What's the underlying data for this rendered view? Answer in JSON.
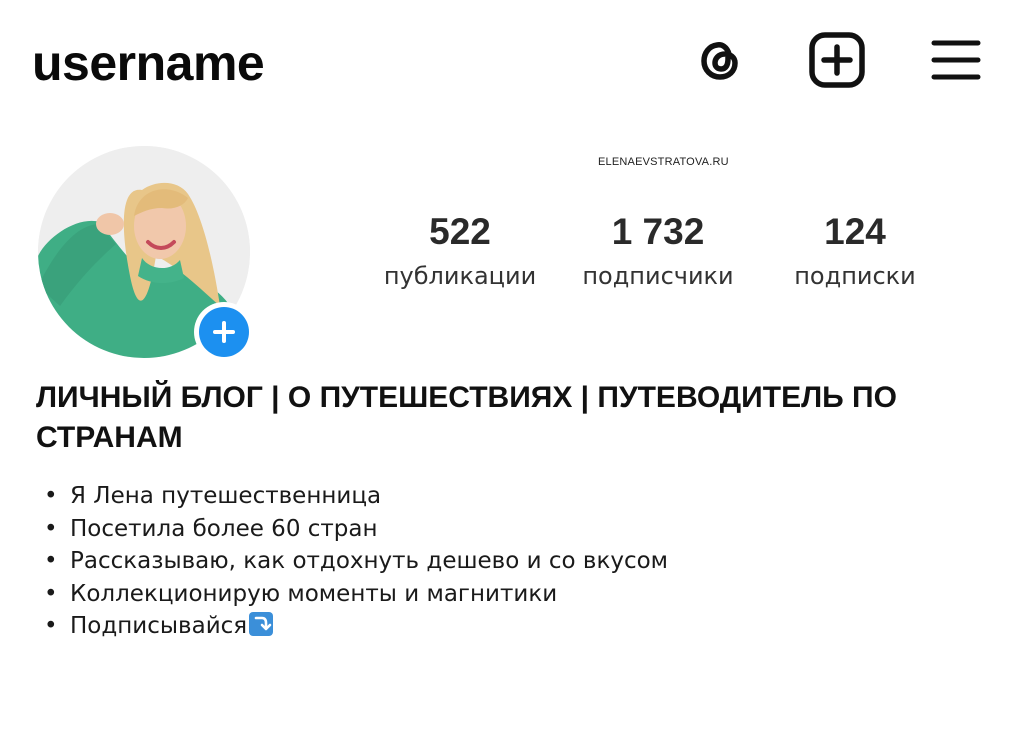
{
  "header": {
    "username": "username",
    "icons": [
      "threads-icon",
      "create-post-icon",
      "menu-icon"
    ]
  },
  "watermark": "ELENAEVSTRATOVA.RU",
  "profile": {
    "stats": [
      {
        "value": "522",
        "label": "публикации"
      },
      {
        "value": "1 732",
        "label": "подписчики"
      },
      {
        "value": "124",
        "label": "подписки"
      }
    ]
  },
  "bio": {
    "title": "ЛИЧНЫЙ БЛОГ | О ПУТЕШЕСТВИЯХ | ПУТЕВОДИТЕЛЬ ПО СТРАНАМ",
    "bullet": "•",
    "lines": [
      "Я Лена путешественница",
      "Посетила более 60 стран",
      "Рассказываю, как отдохнуть дешево и со вкусом",
      "Коллекционирую моменты и магнитики",
      "Подписывайся"
    ],
    "last_line_emoji": "arrow-down-right-icon"
  },
  "colors": {
    "accent": "#1c90f0",
    "text": "#111111",
    "background": "#ffffff"
  }
}
